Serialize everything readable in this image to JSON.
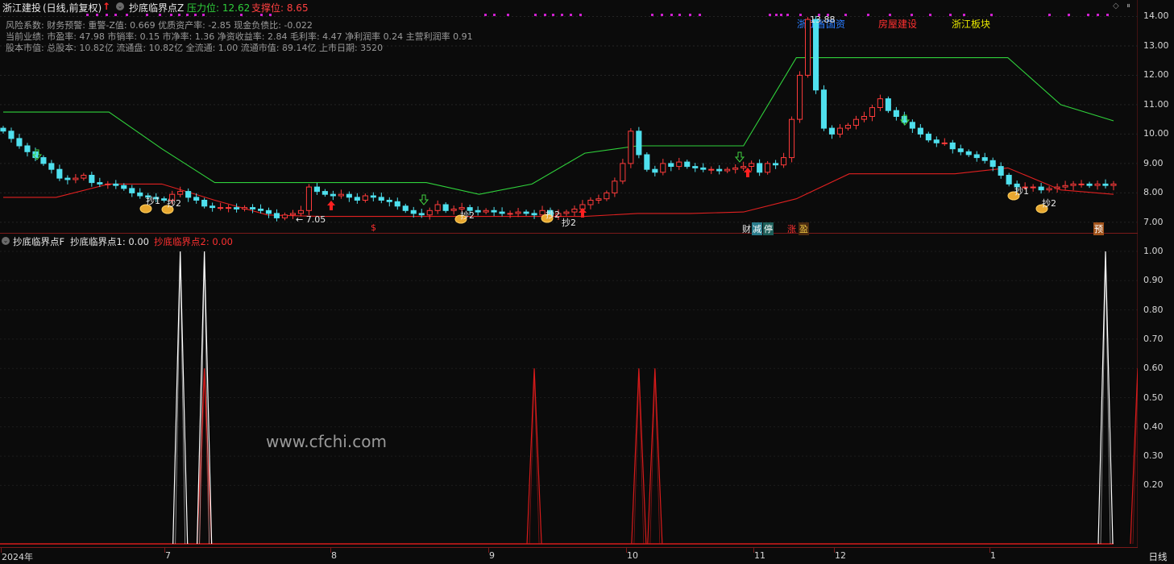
{
  "header": {
    "stock_name": "浙江建投",
    "mode": "(日线,前复权)",
    "indicator_main": "抄底临界点Z",
    "resistance_label": "压力位: 12.62",
    "support_label": "支撑位: 8.65"
  },
  "fundamentals": {
    "line1": "风险系数: 财务预警: 重警-Z值: 0.669 优质资产率: -2.85 现金负债比: -0.022",
    "line2": "当前业绩: 市盈率: 47.98 市销率: 0.15 市净率: 1.36 净资收益率: 2.84 毛利率: 4.47 净利润率 0.24 主营利润率 0.91",
    "line3": "股本市值: 总股本: 10.82亿 流通盘: 10.82亿 全流通: 1.00 流通市值: 89.14亿 上市日期: 3520"
  },
  "sectors": {
    "s1": "浙江省国资",
    "s2": "房屋建设",
    "s3": "浙江板块"
  },
  "annotations": {
    "high": "13.88",
    "low": "7.05",
    "buy1": "抄1",
    "buy2": "抄2",
    "dollar": "$",
    "t_cai": "财",
    "t_jian": "减",
    "t_ting": "停",
    "t_zhang": "涨",
    "t_ying": "盈",
    "t_yu": "预"
  },
  "sub_header": {
    "title": "抄底临界点F",
    "v1": "抄底临界点1: 0.00",
    "v2": "抄底临界点2: 0.00"
  },
  "price_axis": [
    "14.00",
    "13.00",
    "12.00",
    "11.00",
    "10.00",
    "9.00",
    "8.00",
    "7.00"
  ],
  "indicator_axis": [
    "1.00",
    "0.90",
    "0.80",
    "0.70",
    "0.60",
    "0.50",
    "0.40",
    "0.30",
    "0.20"
  ],
  "time_axis": [
    {
      "label": "2024年"
    },
    {
      "label": "7"
    },
    {
      "label": "8"
    },
    {
      "label": "9"
    },
    {
      "label": "10"
    },
    {
      "label": "11"
    },
    {
      "label": "12"
    },
    {
      "label": "1"
    }
  ],
  "watermark": "www.cfchi.com",
  "period_button": "日线",
  "colors": {
    "up": "#ff3b3b",
    "down": "#4fe0ee",
    "resistance_line": "#2fd13b",
    "support_line": "#e02020",
    "signal1": "#ffffff",
    "signal2": "#d81b1b",
    "accent_yellow": "#e8e800",
    "magenta_dots": "#d020d0"
  },
  "chart_data": [
    {
      "type": "candlestick",
      "title": "抄底临界点Z",
      "ylim": [
        6.75,
        14.15
      ],
      "y_ticks": [
        7,
        8,
        9,
        10,
        11,
        12,
        13,
        14
      ],
      "high_annotation": 13.88,
      "low_annotation": 7.05,
      "closes": [
        10.1,
        9.85,
        9.6,
        9.4,
        9.2,
        9.0,
        8.8,
        8.5,
        8.45,
        8.5,
        8.6,
        8.35,
        8.3,
        8.3,
        8.25,
        8.15,
        8.0,
        7.9,
        7.85,
        7.8,
        7.75,
        7.95,
        8.05,
        7.85,
        7.75,
        7.55,
        7.5,
        7.5,
        7.5,
        7.45,
        7.5,
        7.45,
        7.4,
        7.3,
        7.15,
        7.25,
        7.3,
        7.4,
        8.2,
        8.05,
        7.95,
        7.9,
        7.95,
        7.85,
        7.75,
        7.9,
        7.85,
        7.75,
        7.7,
        7.55,
        7.4,
        7.3,
        7.25,
        7.4,
        7.6,
        7.4,
        7.45,
        7.5,
        7.4,
        7.35,
        7.4,
        7.35,
        7.3,
        7.3,
        7.35,
        7.3,
        7.25,
        7.4,
        7.2,
        7.3,
        7.35,
        7.45,
        7.6,
        7.75,
        7.8,
        8.0,
        8.4,
        9.0,
        10.1,
        9.3,
        8.8,
        8.7,
        9.0,
        8.9,
        9.05,
        8.9,
        8.85,
        8.8,
        8.8,
        8.75,
        8.8,
        8.85,
        8.9,
        9.0,
        8.7,
        9.0,
        8.95,
        9.2,
        10.5,
        12.0,
        13.9,
        11.5,
        10.2,
        10.0,
        10.2,
        10.3,
        10.5,
        10.6,
        10.9,
        11.2,
        10.8,
        10.6,
        10.4,
        10.2,
        10.0,
        9.8,
        9.7,
        9.7,
        9.5,
        9.4,
        9.3,
        9.2,
        9.1,
        8.9,
        8.6,
        8.3,
        8.2,
        8.2,
        8.2,
        8.1,
        8.15,
        8.2,
        8.25,
        8.3,
        8.3,
        8.25,
        8.3,
        8.25,
        8.3
      ],
      "resistance_series": [
        10.75,
        10.75,
        10.75,
        9.5,
        8.35,
        8.35,
        8.35,
        8.35,
        8.35,
        7.95,
        8.3,
        9.35,
        9.6,
        9.6,
        9.6,
        12.6,
        12.6,
        12.6,
        12.6,
        12.6,
        11.0,
        10.45
      ],
      "support_series": [
        7.85,
        7.85,
        8.3,
        8.3,
        7.75,
        7.25,
        7.2,
        7.2,
        7.2,
        7.2,
        7.2,
        7.2,
        7.3,
        7.3,
        7.35,
        7.8,
        8.65,
        8.65,
        8.65,
        8.85,
        8.1,
        7.95
      ],
      "resistance_level": 12.62,
      "support_level": 8.65
    },
    {
      "type": "line",
      "title": "抄底临界点F",
      "ylim": [
        0,
        1.0
      ],
      "series": [
        {
          "name": "抄底临界点1",
          "spikes_at_index": [
            22,
            25,
            137
          ],
          "peak": 1.0
        },
        {
          "name": "抄底临界点2",
          "spikes_at_index": [
            25,
            66,
            79,
            81,
            141
          ],
          "peak": 0.6
        }
      ]
    }
  ]
}
